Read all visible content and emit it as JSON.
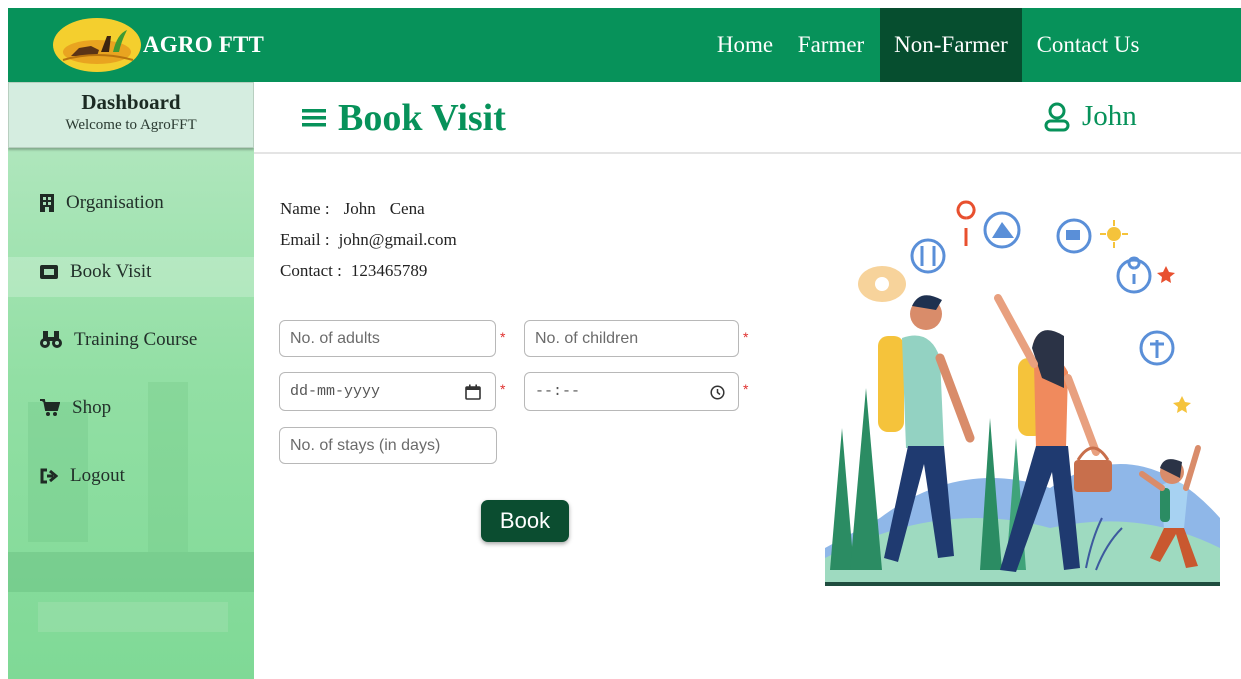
{
  "brand": {
    "name": "AGRO FTT"
  },
  "nav": [
    {
      "label": "Home"
    },
    {
      "label": "Farmer"
    },
    {
      "label": "Non-Farmer",
      "active": true
    },
    {
      "label": "Contact Us"
    }
  ],
  "sidebar": {
    "title": "Dashboard",
    "subtitle": "Welcome to AgroFFT",
    "items": [
      {
        "label": "Organisation",
        "icon": "building-icon"
      },
      {
        "label": "Book Visit",
        "icon": "ticket-icon"
      },
      {
        "label": "Training Course",
        "icon": "binoculars-icon"
      },
      {
        "label": "Shop",
        "icon": "cart-icon"
      },
      {
        "label": "Logout",
        "icon": "sign-out-icon"
      }
    ]
  },
  "header": {
    "title": "Book Visit",
    "menu_icon": "hamburger-icon",
    "user_icon": "user-icon",
    "user_name": "John"
  },
  "profile": {
    "name_label": "Name :",
    "first_name": "John",
    "last_name": "Cena",
    "email_label": "Email :",
    "email": "john@gmail.com",
    "contact_label": "Contact :",
    "contact": "123465789"
  },
  "form": {
    "adults_placeholder": "No. of adults",
    "children_placeholder": "No. of children",
    "date_placeholder": "dd-mm-yyyy",
    "time_placeholder": "--:--",
    "stays_placeholder": "No. of stays (in days)",
    "required_mark": "*",
    "submit_label": "Book"
  },
  "colors": {
    "brand_green": "#07925a",
    "active_nav": "#064e2f",
    "button": "#0b4d30",
    "required": "#e0302e"
  }
}
